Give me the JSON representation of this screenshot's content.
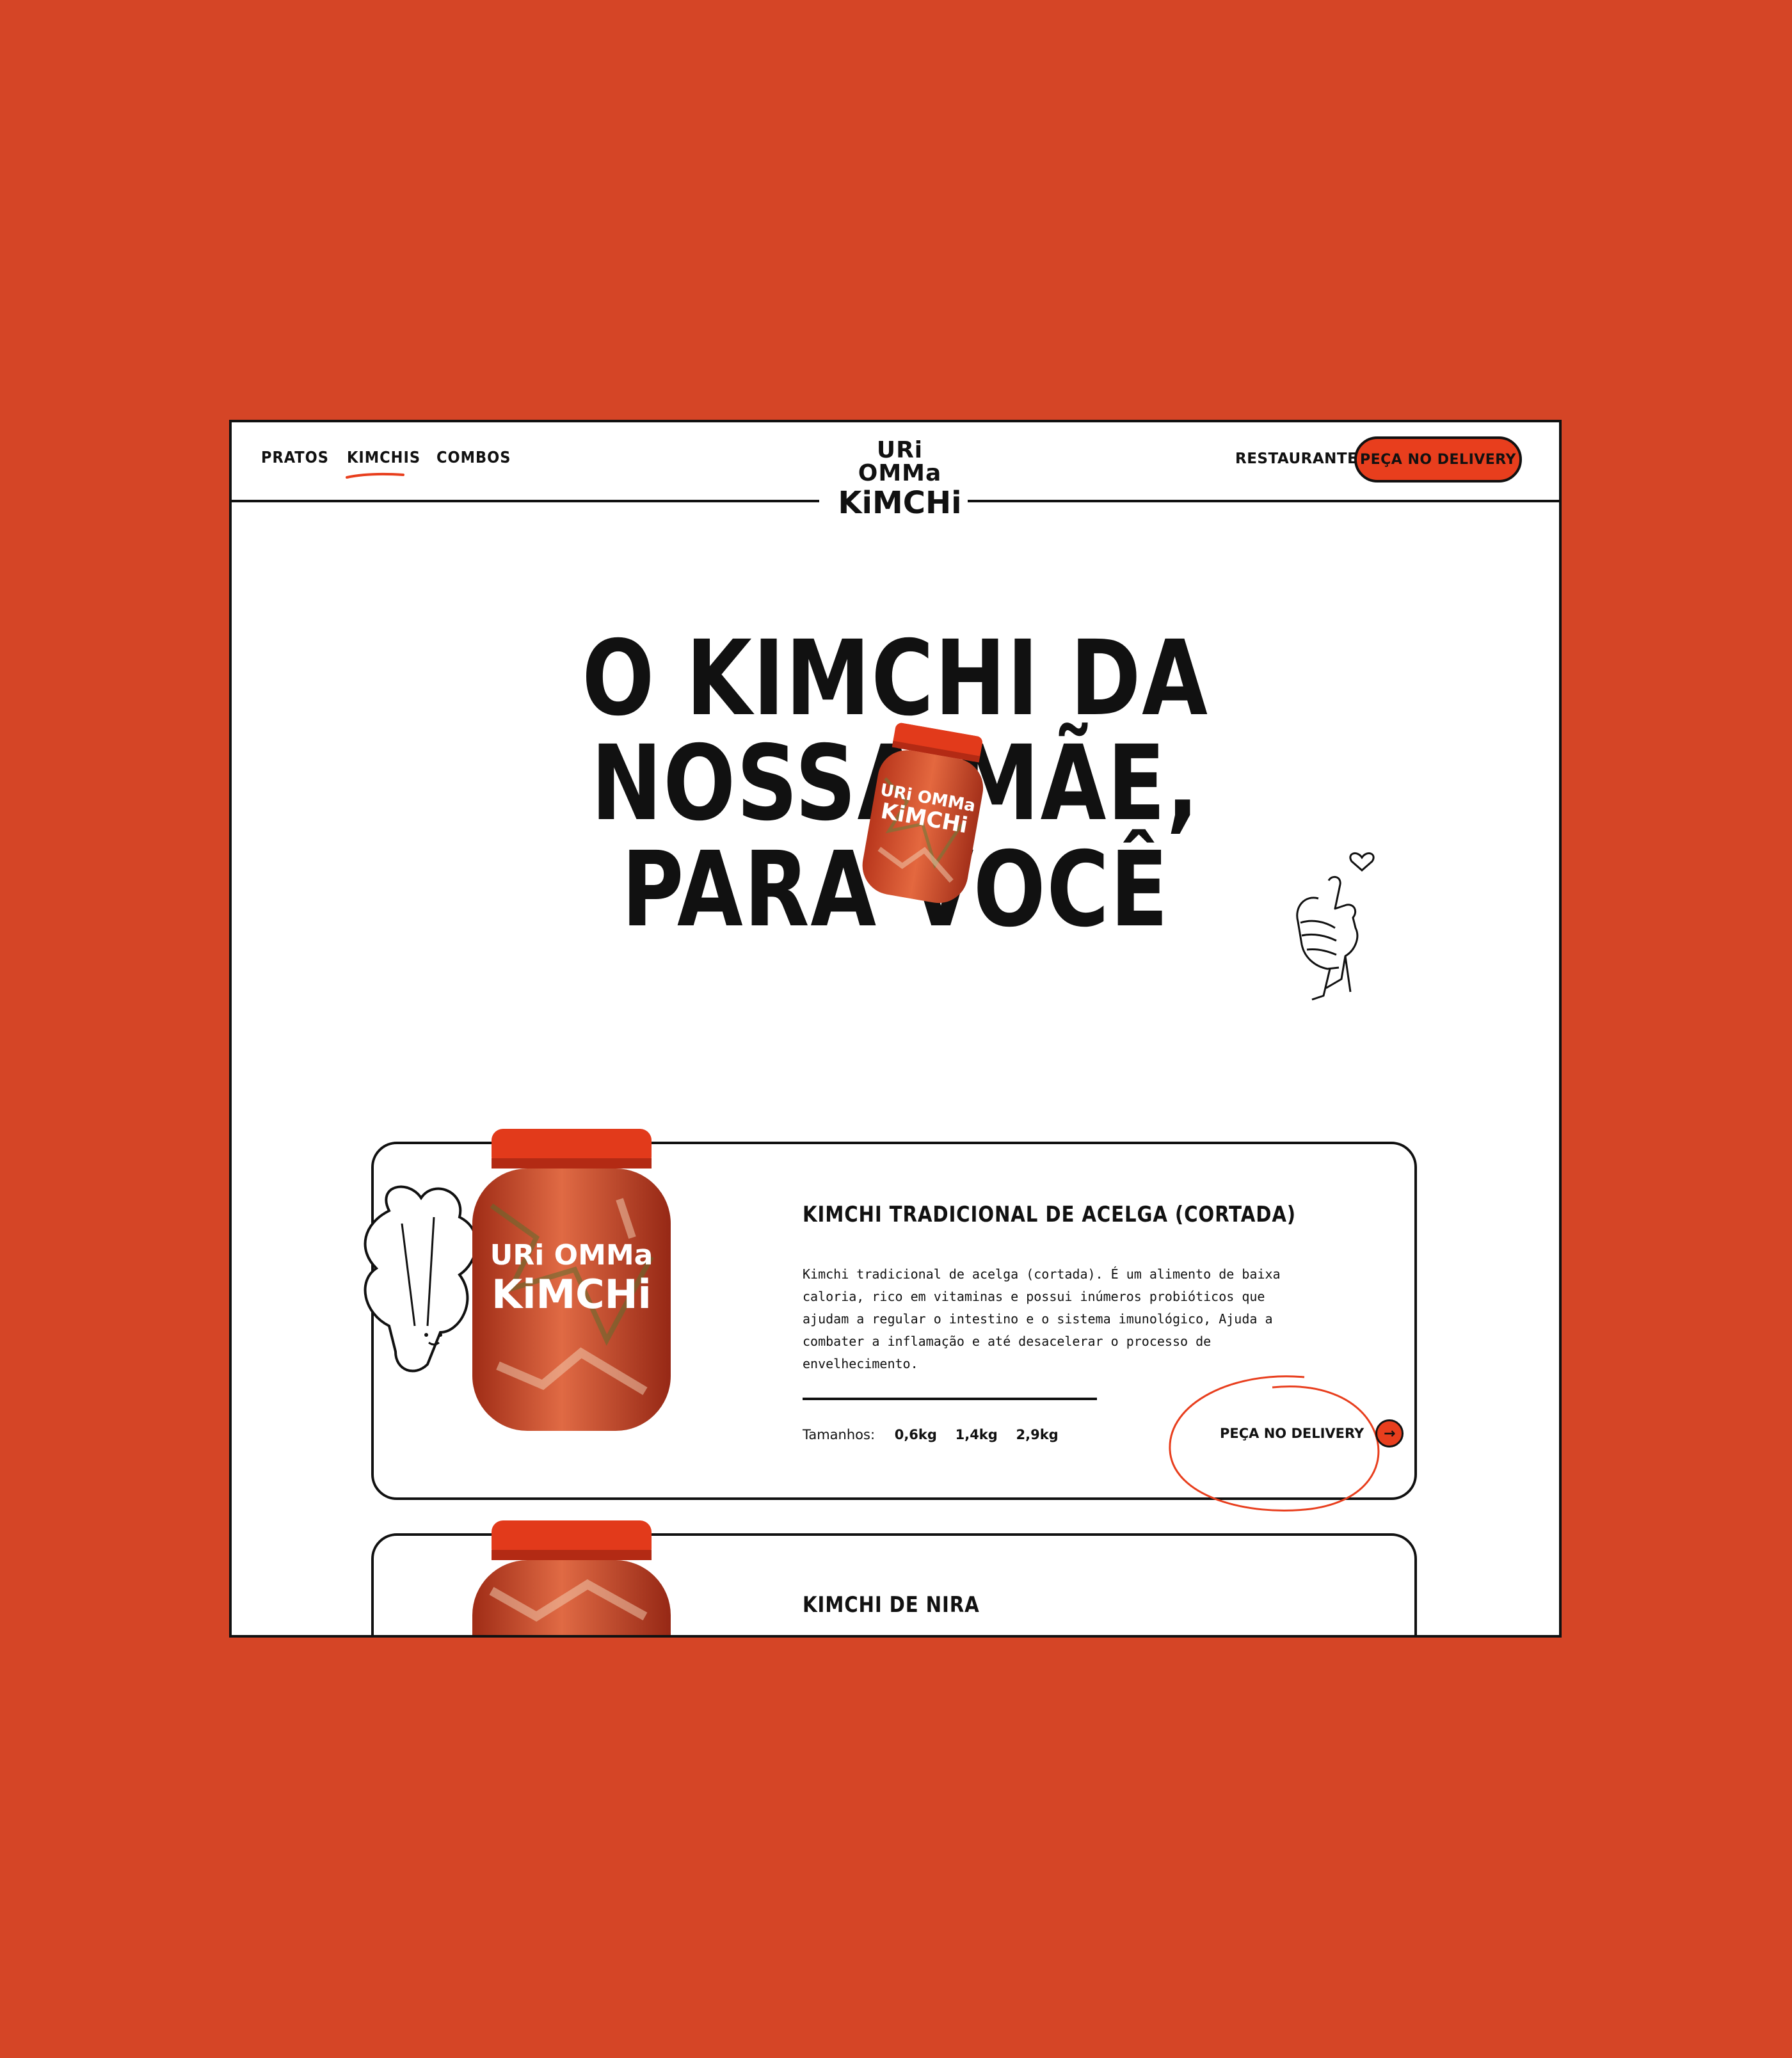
{
  "brand": {
    "logo_line1": "URi OMMa",
    "logo_line2": "KiMCHi",
    "accent_color": "#E83E1D",
    "background_color": "#D54526"
  },
  "nav": {
    "items": [
      {
        "label": "PRATOS",
        "active": false
      },
      {
        "label": "KIMCHIS",
        "active": true
      },
      {
        "label": "COMBOS",
        "active": false
      }
    ],
    "restaurant_link": "RESTAURANTE",
    "delivery_button": "PEÇA NO DELIVERY"
  },
  "hero": {
    "line1": "O KIMCHI DA",
    "line2": "NOSSA MÃE,",
    "line3": "PARA VOCÊ",
    "jar_logo_line1": "URi OMMa",
    "jar_logo_line2": "KiMCHi",
    "decoration_icon": "finger-heart-hand-icon"
  },
  "products": [
    {
      "title": "KIMCHI TRADICIONAL DE ACELGA (CORTADA)",
      "description": "Kimchi tradicional de acelga (cortada). É um alimento de baixa caloria, rico em vitaminas e possui inúmeros probióticos que ajudam a regular o intestino e o sistema imunológico, Ajuda a combater a inflamação e até desacelerar o processo de envelhecimento.",
      "sizes_label": "Tamanhos:",
      "sizes": [
        "0,6kg",
        "1,4kg",
        "2,9kg"
      ],
      "cta": "PEÇA NO DELIVERY",
      "jar_logo_line1": "URi OMMa",
      "jar_logo_line2": "KiMCHi"
    },
    {
      "title": "KIMCHI DE NIRA"
    }
  ]
}
